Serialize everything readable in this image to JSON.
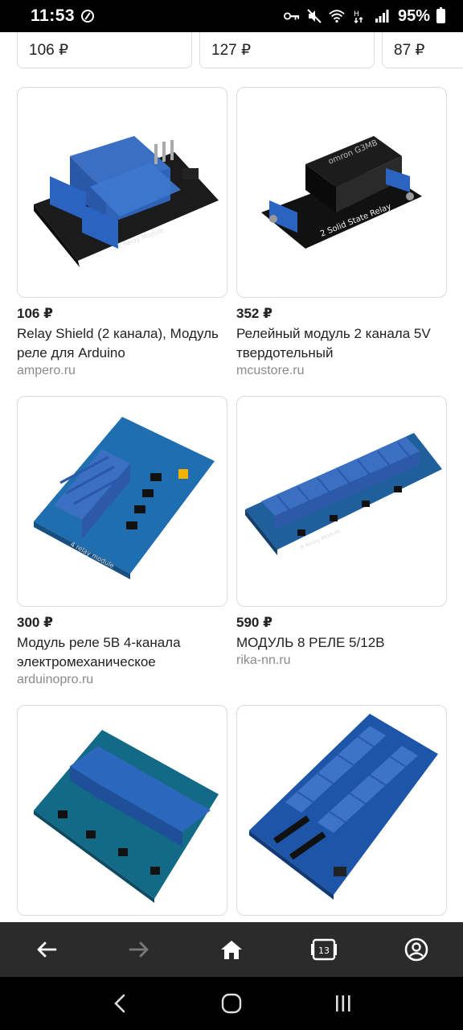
{
  "status_bar": {
    "time": "11:53",
    "battery": "95%"
  },
  "top_row": [
    {
      "price": "106 ₽"
    },
    {
      "price": "127 ₽"
    },
    {
      "price": "87 ₽"
    }
  ],
  "results": [
    {
      "price": "106 ₽",
      "title": "Relay Shield (2 канала), Модуль реле для Arduino",
      "source": "ampero.ru",
      "image": "2-relay-module-photo"
    },
    {
      "price": "352 ₽",
      "title": "Релейный модуль 2 канала 5V твердотельный",
      "source": "mcustore.ru",
      "image": "solid-state-relay-photo"
    },
    {
      "price": "300 ₽",
      "title": "Модуль реле 5В 4-канала электромеханическое",
      "source": "arduinopro.ru",
      "image": "4-relay-module-photo"
    },
    {
      "price": "590 ₽",
      "title": "МОДУЛЬ 8 РЕЛЕ 5/12В",
      "source": "rika-nn.ru",
      "image": "8-relay-module-photo"
    },
    {
      "price": "",
      "title": "",
      "source": "",
      "image": "4-relay-module-teal-photo"
    },
    {
      "price": "",
      "title": "",
      "source": "",
      "image": "16-relay-module-photo"
    }
  ],
  "browser_bar": {
    "tab_count": "13",
    "icons": [
      "back-arrow-icon",
      "forward-arrow-icon",
      "home-icon",
      "tabs-icon",
      "account-icon"
    ]
  },
  "system_nav": {
    "icons": [
      "back-chevron-icon",
      "home-circle-icon",
      "recents-icon"
    ]
  }
}
